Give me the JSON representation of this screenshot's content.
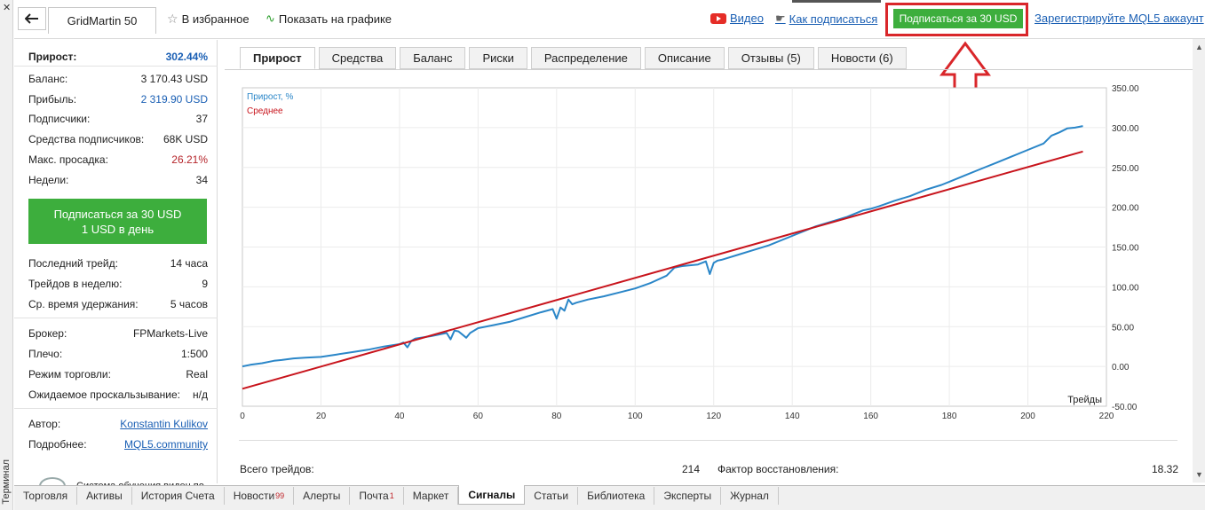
{
  "side_strip": {
    "close": "✕",
    "label": "Терминал"
  },
  "header": {
    "back_icon": "arrow-left-icon",
    "title": "GridMartin 50",
    "favorites_label": "В избранное",
    "show_on_chart_label": "Показать на графике",
    "video_label": "Видео",
    "how_to_subscribe_label": "Как подписаться",
    "subscribe_button": "Подписаться за 30 USD",
    "register_label": "Зарегистрируйте MQL5 аккаунт"
  },
  "stats": {
    "growth": {
      "label": "Прирост:",
      "value": "302.44%"
    },
    "balance": {
      "label": "Баланс:",
      "value": "3 170.43 USD"
    },
    "profit": {
      "label": "Прибыль:",
      "value": "2 319.90 USD"
    },
    "subscribers": {
      "label": "Подписчики:",
      "value": "37"
    },
    "subscriber_funds": {
      "label": "Средства подписчиков:",
      "value": "68K USD"
    },
    "max_drawdown": {
      "label": "Макс. просадка:",
      "value": "26.21%"
    },
    "weeks": {
      "label": "Недели:",
      "value": "34"
    }
  },
  "subscribe_panel": {
    "line1": "Подписаться за 30 USD",
    "line2": "1 USD в день"
  },
  "trade_info": {
    "last_trade": {
      "label": "Последний трейд:",
      "value": "14 часа"
    },
    "trades_per_week": {
      "label": "Трейдов в неделю:",
      "value": "9"
    },
    "avg_hold": {
      "label": "Ср. время удержания:",
      "value": "5 часов"
    }
  },
  "broker_info": {
    "broker": {
      "label": "Брокер:",
      "value": "FPMarkets-Live"
    },
    "leverage": {
      "label": "Плечо:",
      "value": "1:500"
    },
    "trade_mode": {
      "label": "Режим торговли:",
      "value": "Real"
    },
    "slippage": {
      "label": "Ожидаемое проскальзывание:",
      "value": "н/д"
    }
  },
  "author_info": {
    "author": {
      "label": "Автор:",
      "value": "Konstantin Kulikov"
    },
    "details": {
      "label": "Подробнее:",
      "value": "MQL5.community"
    },
    "cut_text": "Система обучения виден по"
  },
  "tabs": [
    "Прирост",
    "Средства",
    "Баланс",
    "Риски",
    "Распределение",
    "Описание",
    "Отзывы (5)",
    "Новости (6)"
  ],
  "summary": {
    "total_trades_label": "Всего трейдов:",
    "total_trades_value": "214",
    "recovery_label": "Фактор восстановления:",
    "recovery_value": "18.32"
  },
  "bottom_tabs": [
    {
      "label": "Торговля",
      "badge": ""
    },
    {
      "label": "Активы",
      "badge": ""
    },
    {
      "label": "История Счета",
      "badge": ""
    },
    {
      "label": "Новости",
      "badge": "99"
    },
    {
      "label": "Алерты",
      "badge": ""
    },
    {
      "label": "Почта",
      "badge": "1"
    },
    {
      "label": "Маркет",
      "badge": ""
    },
    {
      "label": "Сигналы",
      "badge": ""
    },
    {
      "label": "Статьи",
      "badge": ""
    },
    {
      "label": "Библиотека",
      "badge": ""
    },
    {
      "label": "Эксперты",
      "badge": ""
    },
    {
      "label": "Журнал",
      "badge": ""
    }
  ],
  "colors": {
    "accent_green": "#3dae3d",
    "growth_line": "#2a86c8",
    "average_line": "#c8141c",
    "highlight_red": "#d9262a",
    "link_blue": "#1a5fb4"
  },
  "chart_data": {
    "type": "line",
    "xlabel": "Трейды",
    "xlim": [
      0,
      220
    ],
    "ylim": [
      -50,
      350
    ],
    "xticks": [
      0,
      20,
      40,
      60,
      80,
      100,
      120,
      140,
      160,
      180,
      200,
      220
    ],
    "yticks": [
      -50,
      0,
      50,
      100,
      150,
      200,
      250,
      300,
      350
    ],
    "xtick_labels": [
      "0",
      "20",
      "40",
      "60",
      "80",
      "100",
      "120",
      "140",
      "160",
      "180",
      "200",
      "220"
    ],
    "ytick_labels": [
      "-50.00",
      "0.00",
      "50.00",
      "100.00",
      "150.00",
      "200.00",
      "250.00",
      "300.00",
      "350.00"
    ],
    "series": [
      {
        "name": "Прирост, %",
        "x": [
          0,
          2,
          5,
          8,
          10,
          13,
          16,
          20,
          24,
          28,
          32,
          36,
          40,
          41,
          42,
          43,
          44,
          48,
          52,
          53,
          54,
          55,
          56,
          57,
          58,
          60,
          64,
          68,
          72,
          76,
          79,
          80,
          81,
          82,
          83,
          84,
          85,
          88,
          92,
          96,
          100,
          104,
          108,
          110,
          112,
          116,
          118,
          119,
          120,
          121,
          122,
          126,
          130,
          134,
          138,
          142,
          146,
          150,
          154,
          158,
          160,
          162,
          166,
          170,
          174,
          178,
          180,
          184,
          188,
          192,
          196,
          200,
          204,
          206,
          208,
          210,
          212,
          214
        ],
        "y": [
          0,
          2,
          4,
          7,
          8,
          10,
          11,
          12,
          15,
          18,
          21,
          25,
          28,
          30,
          24,
          32,
          35,
          38,
          42,
          34,
          45,
          44,
          40,
          36,
          42,
          48,
          52,
          56,
          62,
          68,
          72,
          60,
          74,
          70,
          84,
          78,
          80,
          84,
          88,
          93,
          98,
          105,
          114,
          124,
          126,
          128,
          132,
          116,
          130,
          133,
          134,
          140,
          146,
          152,
          160,
          168,
          176,
          182,
          188,
          196,
          198,
          201,
          208,
          214,
          222,
          228,
          232,
          240,
          248,
          256,
          264,
          272,
          280,
          290,
          294,
          299,
          300,
          302
        ]
      },
      {
        "name": "Среднее",
        "x": [
          0,
          214
        ],
        "y": [
          -28,
          270
        ]
      }
    ]
  }
}
